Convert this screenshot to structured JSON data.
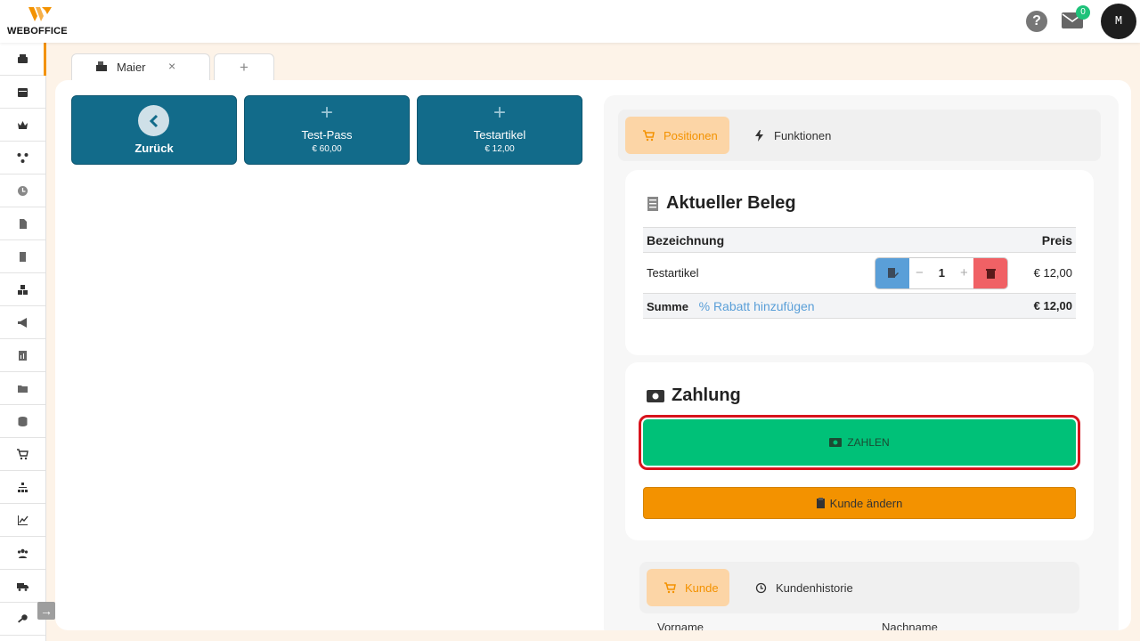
{
  "brand": {
    "logo_text": "WEBOFFICE"
  },
  "header": {
    "help_symbol": "?",
    "mail_badge": "0",
    "avatar_initial": "M"
  },
  "sidebar": {
    "items": [
      {
        "icon": "cash-register-icon"
      },
      {
        "icon": "calendar-icon"
      },
      {
        "icon": "crown-icon"
      },
      {
        "icon": "network-icon"
      },
      {
        "icon": "clock-icon"
      },
      {
        "icon": "document-icon"
      },
      {
        "icon": "receipt-icon"
      },
      {
        "icon": "boxes-icon"
      },
      {
        "icon": "megaphone-icon"
      },
      {
        "icon": "report-icon"
      },
      {
        "icon": "folder-icon"
      },
      {
        "icon": "database-icon"
      },
      {
        "icon": "cart-icon"
      },
      {
        "icon": "hierarchy-icon"
      },
      {
        "icon": "chart-icon"
      },
      {
        "icon": "users-icon"
      },
      {
        "icon": "truck-icon"
      },
      {
        "icon": "key-icon"
      }
    ]
  },
  "tabs": [
    {
      "label": "Maier",
      "close": "×"
    },
    {
      "label": "+"
    }
  ],
  "products": {
    "back_label": "Zurück",
    "items": [
      {
        "plus": "+",
        "name": "Test-Pass",
        "price": "€ 60,00"
      },
      {
        "plus": "+",
        "name": "Testartikel",
        "price": "€ 12,00"
      }
    ]
  },
  "right_tabs": {
    "positionen": "Positionen",
    "funktionen": "Funktionen"
  },
  "beleg": {
    "title": "Aktueller Beleg",
    "col_name": "Bezeichnung",
    "col_price": "Preis",
    "row": {
      "name": "Testartikel",
      "qty": "1",
      "minus": "−",
      "plus": "+",
      "price": "€ 12,00"
    },
    "sum_label": "Summe",
    "rabatt_label": "Rabatt hinzufügen",
    "sum_value": "€ 12,00"
  },
  "zahlung": {
    "title": "Zahlung",
    "pay_label": "ZAHLEN",
    "change_customer_label": "Kunde ändern"
  },
  "customer_tabs": {
    "kunde": "Kunde",
    "historie": "Kundenhistorie"
  },
  "customer_fields": {
    "vorname": "Vorname",
    "nachname": "Nachname"
  },
  "colors": {
    "accent": "#f39200",
    "tile": "#126b8a",
    "pay": "#00c178",
    "delete": "#f06165",
    "edit": "#5a9fd8"
  }
}
